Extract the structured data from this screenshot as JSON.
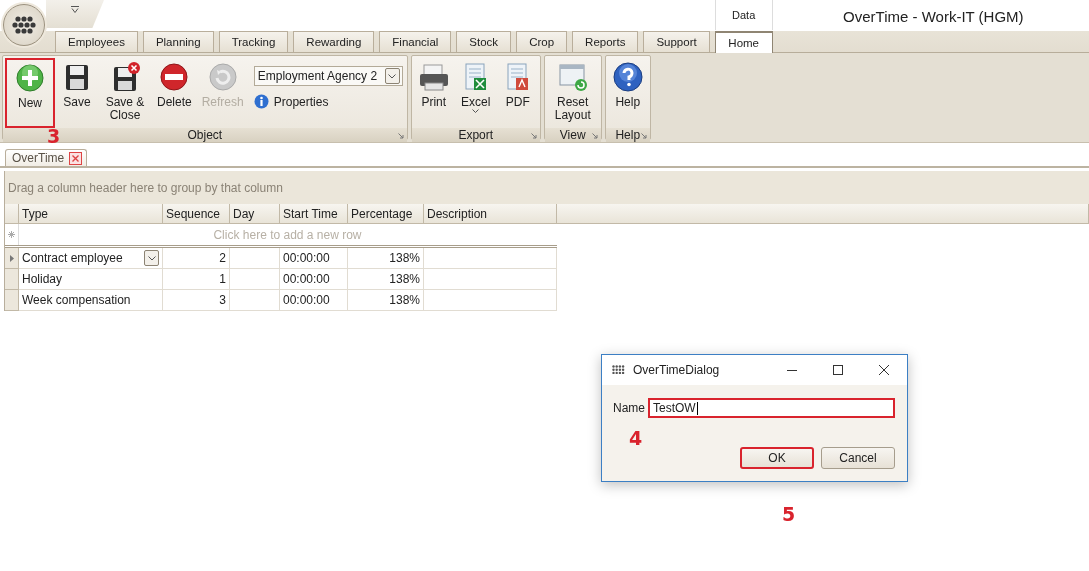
{
  "window": {
    "title": "OverTime - Work-IT (HGM)"
  },
  "ribbon": {
    "tabs": [
      {
        "label": "Employees",
        "selected": false
      },
      {
        "label": "Planning",
        "selected": false
      },
      {
        "label": "Tracking",
        "selected": false
      },
      {
        "label": "Rewarding",
        "selected": false
      },
      {
        "label": "Financial",
        "selected": false
      },
      {
        "label": "Stock",
        "selected": false
      },
      {
        "label": "Crop",
        "selected": false
      },
      {
        "label": "Reports",
        "selected": false
      },
      {
        "label": "Support",
        "selected": false
      }
    ],
    "context_group": {
      "label": "Data",
      "tabs": [
        {
          "label": "Home",
          "selected": true
        }
      ]
    },
    "groups": [
      {
        "label": "Object",
        "items": [
          {
            "kind": "large",
            "label": "New",
            "disabled": false,
            "annotation": "3"
          },
          {
            "kind": "large",
            "label": "Save",
            "disabled": false
          },
          {
            "kind": "large",
            "label": "Save & Close",
            "disabled": false
          },
          {
            "kind": "large",
            "label": "Delete",
            "disabled": false
          },
          {
            "kind": "large",
            "label": "Refresh",
            "disabled": true
          },
          {
            "kind": "stack",
            "items": [
              {
                "kind": "dropdown",
                "value": "Employment Agency 2"
              },
              {
                "kind": "small",
                "label": "Properties"
              }
            ]
          }
        ]
      },
      {
        "label": "Export",
        "items": [
          {
            "kind": "large",
            "label": "Print",
            "disabled": false
          },
          {
            "kind": "large",
            "label": "Excel",
            "disabled": false,
            "has_menu": true
          },
          {
            "kind": "large",
            "label": "PDF",
            "disabled": false
          }
        ]
      },
      {
        "label": "View",
        "items": [
          {
            "kind": "large",
            "label": "Reset Layout",
            "disabled": false
          }
        ]
      },
      {
        "label": "Help",
        "items": [
          {
            "kind": "large",
            "label": "Help",
            "disabled": false
          }
        ]
      }
    ]
  },
  "document_tabs": [
    {
      "label": "OverTime",
      "selected": true
    }
  ],
  "grid": {
    "group_panel_hint": "Drag a column header here to group by that column",
    "columns": [
      "Type",
      "Sequence",
      "Day",
      "Start Time",
      "Percentage",
      "Description"
    ],
    "new_row_hint": "Click here to add a new row",
    "rows": [
      {
        "current": true,
        "editing": true,
        "cells": [
          "Contract employee",
          "2",
          "",
          "00:00:00",
          "138%",
          ""
        ]
      },
      {
        "current": false,
        "editing": false,
        "cells": [
          "Holiday",
          "1",
          "",
          "00:00:00",
          "138%",
          ""
        ]
      },
      {
        "current": false,
        "editing": false,
        "cells": [
          "Week compensation",
          "3",
          "",
          "00:00:00",
          "138%",
          ""
        ]
      }
    ]
  },
  "dialog": {
    "title": "OverTimeDialog",
    "name_label": "Name",
    "name_value": "TestOW",
    "name_annotation": "4",
    "buttons": [
      {
        "label": "OK",
        "annotation": "5"
      },
      {
        "label": "Cancel"
      }
    ]
  }
}
